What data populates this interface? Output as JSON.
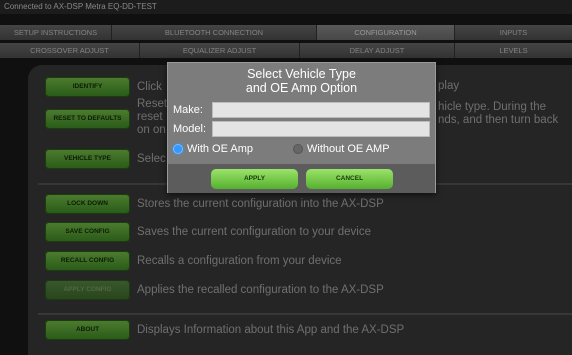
{
  "status": {
    "text": "Connected to AX-DSP Metra EQ-DD-TEST"
  },
  "tabs_row1": [
    {
      "label": "SETUP INSTRUCTIONS"
    },
    {
      "label": "BLUETOOTH CONNECTION"
    },
    {
      "label": "CONFIGURATION"
    },
    {
      "label": "INPUTS"
    }
  ],
  "tabs_row2": [
    {
      "label": "CROSSOVER ADJUST"
    },
    {
      "label": "EQUALIZER ADJUST"
    },
    {
      "label": "DELAY ADJUST"
    },
    {
      "label": "LEVELS"
    }
  ],
  "config": {
    "identify": {
      "label": "IDENTIFY",
      "desc": "Click",
      "desc_right": "play"
    },
    "reset": {
      "label": "RESET TO DEFAULTS",
      "desc_line1": "Reset",
      "desc_line2": "reset",
      "desc_line3": "on on",
      "desc_right_line1": "hicle type. During the",
      "desc_right_line2": "nds, and then turn back"
    },
    "vehicle_type": {
      "label": "VEHICLE TYPE",
      "desc": "Selec"
    },
    "lock_down": {
      "label": "LOCK DOWN",
      "desc": "Stores the current configuration into the AX-DSP"
    },
    "save_config": {
      "label": "SAVE CONFIG",
      "desc": "Saves the current configuration to your device"
    },
    "recall_config": {
      "label": "RECALL CONFIG",
      "desc": "Recalls a configuration from your device"
    },
    "apply_config": {
      "label": "APPLY CONFIG",
      "desc": "Applies the recalled configuration to the AX-DSP"
    },
    "about": {
      "label": "ABOUT",
      "desc": "Displays Information about this App and the AX-DSP"
    }
  },
  "dialog": {
    "title_line1": "Select Vehicle Type",
    "title_line2": "and OE Amp Option",
    "make_label": "Make:",
    "make_value": "",
    "model_label": "Model:",
    "model_value": "",
    "option_with": "With OE Amp",
    "option_without": "Without OE AMP",
    "apply_label": "APPLY",
    "cancel_label": "CANCEL"
  },
  "colors": {
    "accent_green": "#55b02e",
    "radio_selected": "#3399ff",
    "panel_bg": "#3a3a3a"
  }
}
